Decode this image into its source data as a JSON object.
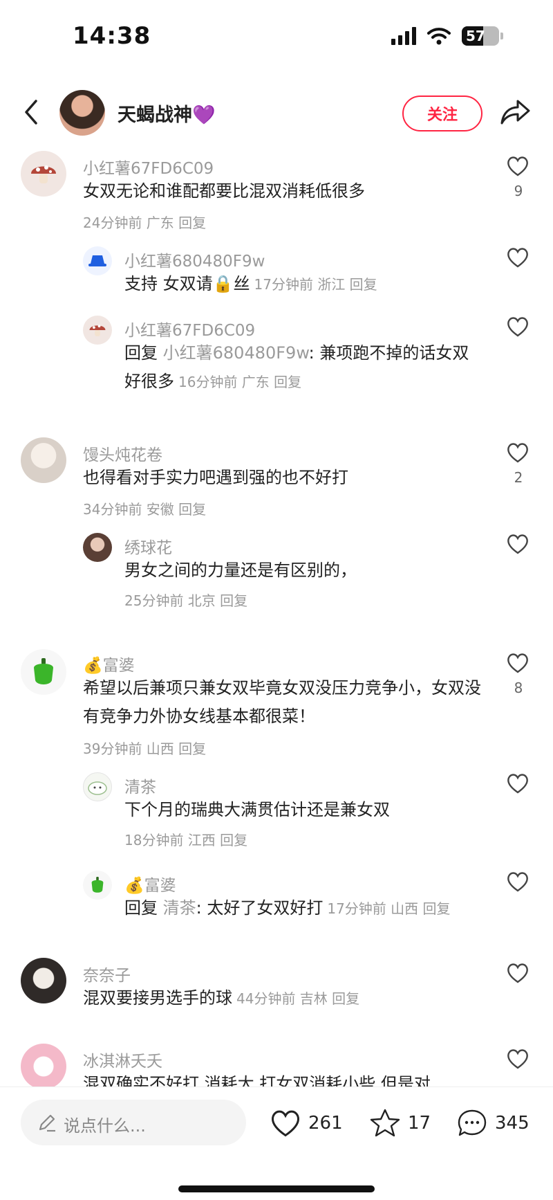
{
  "status": {
    "time": "14:38",
    "battery": "57",
    "battery_level": 0.57
  },
  "header": {
    "username": "天蝎战神💜",
    "follow_label": "关注"
  },
  "comments": [
    {
      "username": "小红薯67FD6C09",
      "text": "女双无论和谁配都要比混双消耗低很多",
      "meta": "24分钟前 广东 回复",
      "likes": "9",
      "replies": [
        {
          "username": "小红薯680480F9w",
          "text": "支持  女双请🔒丝",
          "meta": "17分钟前 浙江 回复"
        },
        {
          "username": "小红薯67FD6C09",
          "prefix": "回复",
          "quote": "小红薯680480F9w",
          "text": ": 兼项跑不掉的话女双好很多",
          "meta": "16分钟前 广东 回复"
        }
      ]
    },
    {
      "username": "馒头炖花卷",
      "text": "也得看对手实力吧遇到强的也不好打",
      "meta": "34分钟前 安徽 回复",
      "likes": "2",
      "replies": [
        {
          "username": "绣球花",
          "text": "男女之间的力量还是有区别的，",
          "meta": "25分钟前 北京 回复"
        }
      ]
    },
    {
      "username": "💰富婆",
      "text": "希望以后兼项只兼女双毕竟女双没压力竞争小，女双没有竞争力外协女线基本都很菜！",
      "meta": "39分钟前 山西 回复",
      "likes": "8",
      "replies": [
        {
          "username": "清茶",
          "text": "下个月的瑞典大满贯估计还是兼女双",
          "meta": "18分钟前 江西 回复"
        },
        {
          "username": "💰富婆",
          "prefix": "回复",
          "quote": "清茶",
          "text": ": 太好了女双好打",
          "meta": "17分钟前 山西 回复"
        }
      ]
    },
    {
      "username": "奈奈子",
      "text": "混双要接男选手的球",
      "meta": "44分钟前 吉林 回复"
    },
    {
      "username": "冰淇淋夭夭",
      "text": "混双确实不好打  消耗大  打女双消耗小些  但是对"
    }
  ],
  "bottom": {
    "placeholder": "说点什么...",
    "likes": "261",
    "stars": "17",
    "comments": "345"
  },
  "icons": [
    "back-arrow-icon",
    "share-icon",
    "heart-icon",
    "star-icon",
    "comment-bubble-icon",
    "pencil-icon",
    "mushroom-icon",
    "bucket-hat-icon",
    "pepper-icon",
    "money-bag-icon",
    "lock-icon"
  ],
  "colors": {
    "accent": "#ff2442",
    "muted": "#9a9a9a",
    "text": "#222222"
  }
}
